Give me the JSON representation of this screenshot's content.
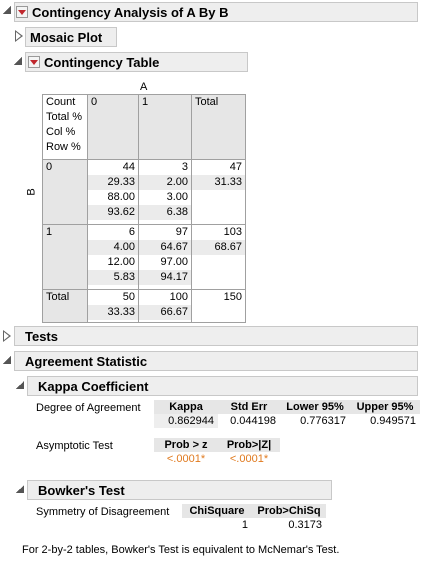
{
  "report": {
    "title": "Contingency Analysis of A By B"
  },
  "mosaic": {
    "title": "Mosaic Plot"
  },
  "contingency": {
    "title": "Contingency Table",
    "col_var": "A",
    "row_var": "B",
    "legend": [
      "Count",
      "Total %",
      "Col %",
      "Row %"
    ],
    "col_headers": [
      "0",
      "1",
      "Total"
    ],
    "rows": [
      {
        "label": "0",
        "cells": [
          [
            "44",
            "29.33",
            "88.00",
            "93.62"
          ],
          [
            "3",
            "2.00",
            "3.00",
            "6.38"
          ]
        ],
        "total": [
          "47",
          "31.33"
        ]
      },
      {
        "label": "1",
        "cells": [
          [
            "6",
            "4.00",
            "12.00",
            "5.83"
          ],
          [
            "97",
            "64.67",
            "97.00",
            "94.17"
          ]
        ],
        "total": [
          "103",
          "68.67"
        ]
      }
    ],
    "total_row": {
      "label": "Total",
      "cells": [
        [
          "50",
          "33.33"
        ],
        [
          "100",
          "66.67"
        ]
      ],
      "grand": "150"
    }
  },
  "tests": {
    "title": "Tests"
  },
  "agreement": {
    "title": "Agreement Statistic",
    "kappa": {
      "title": "Kappa Coefficient",
      "row1_label": "Degree of Agreement",
      "headers": [
        "Kappa",
        "Std Err",
        "Lower 95%",
        "Upper 95%"
      ],
      "values": [
        "0.862944",
        "0.044198",
        "0.776317",
        "0.949571"
      ],
      "row2_label": "Asymptotic Test",
      "test_headers": [
        "Prob > z",
        "Prob>|Z|"
      ],
      "test_values": [
        "<.0001*",
        "<.0001*"
      ]
    },
    "bowker": {
      "title": "Bowker's Test",
      "row_label": "Symmetry of Disagreement",
      "headers": [
        "ChiSquare",
        "Prob>ChiSq"
      ],
      "values": [
        "1",
        "0.3173"
      ]
    },
    "note": "For 2-by-2 tables, Bowker's Test is equivalent to McNemar's Test."
  },
  "colors": {
    "significant": "#e07a1f",
    "menu_triangle": "#c0272d",
    "header_bg": "#eeeeee"
  }
}
